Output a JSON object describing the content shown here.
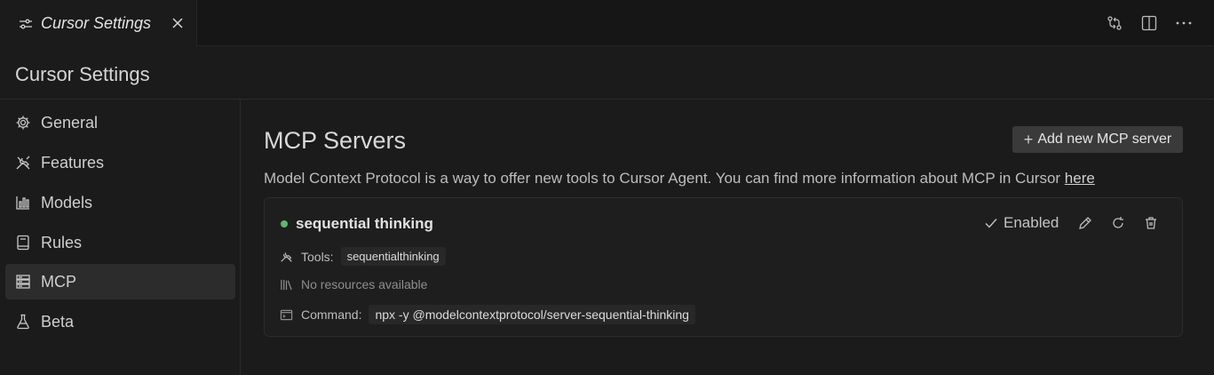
{
  "tab": {
    "title": "Cursor Settings"
  },
  "header": {
    "title": "Cursor Settings"
  },
  "sidebar": {
    "items": [
      {
        "label": "General",
        "icon": "gear-icon"
      },
      {
        "label": "Features",
        "icon": "tools-icon"
      },
      {
        "label": "Models",
        "icon": "bar-chart-icon"
      },
      {
        "label": "Rules",
        "icon": "book-icon"
      },
      {
        "label": "MCP",
        "icon": "server-icon",
        "active": true
      },
      {
        "label": "Beta",
        "icon": "flask-icon"
      }
    ]
  },
  "main": {
    "title": "MCP Servers",
    "add_button": "Add new MCP server",
    "description": "Model Context Protocol is a way to offer new tools to Cursor Agent. You can find more information about MCP in Cursor",
    "description_link": "here",
    "server": {
      "name": "sequential thinking",
      "status": "Enabled",
      "tools_label": "Tools:",
      "tool": "sequentialthinking",
      "resources": "No resources available",
      "command_label": "Command:",
      "command": "npx -y @modelcontextprotocol/server-sequential-thinking"
    }
  },
  "colors": {
    "status_dot": "#5fb870",
    "background": "#1b1b1b",
    "active_item": "#2c2c2c"
  }
}
